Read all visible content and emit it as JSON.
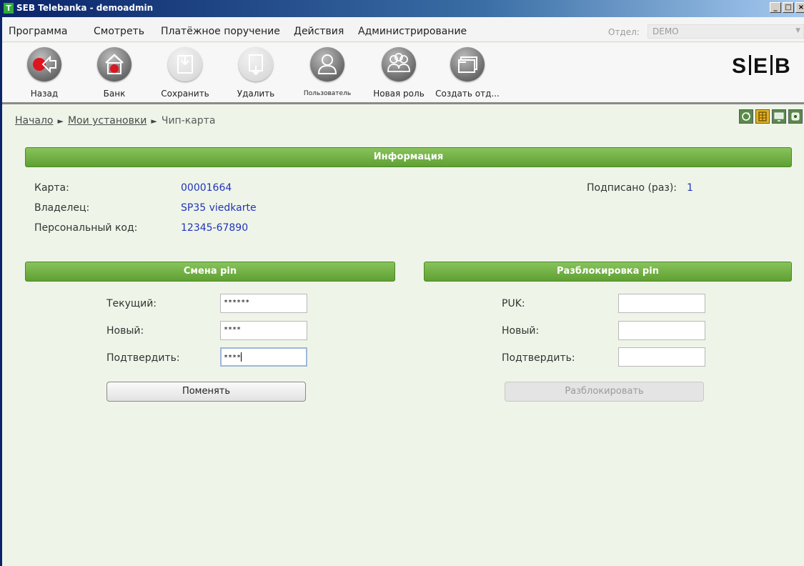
{
  "window": {
    "title": "SEB Telebanka - demoadmin",
    "app_icon_letter": "T",
    "min_glyph": "_",
    "max_glyph": "□",
    "close_glyph": "×"
  },
  "menu": {
    "items": [
      "Программа",
      "Смотреть",
      "Платёжное поручение",
      "Действия",
      "Администрирование"
    ],
    "department_label": "Отдел:",
    "department_value": "DEMO"
  },
  "toolbar": {
    "buttons": [
      {
        "label": "Назад",
        "icon": "back-arrow-icon",
        "enabled": true
      },
      {
        "label": "Банк",
        "icon": "bank-icon",
        "enabled": true
      },
      {
        "label": "Сохранить",
        "icon": "save-icon",
        "enabled": false
      },
      {
        "label": "Удалить",
        "icon": "delete-icon",
        "enabled": false
      },
      {
        "label": "Пользователь",
        "icon": "user-icon",
        "enabled": true
      },
      {
        "label": "Новая роль",
        "icon": "group-icon",
        "enabled": true
      },
      {
        "label": "Создать отд...",
        "icon": "folders-icon",
        "enabled": true
      }
    ],
    "logo": {
      "left": "S",
      "mid": "E",
      "right": "B"
    }
  },
  "breadcrumb": {
    "items": [
      "Начало",
      "Мои установки",
      "Чип-карта"
    ],
    "separator": "►"
  },
  "info": {
    "header": "Информация",
    "card_label": "Карта:",
    "card_value": "00001664",
    "owner_label": "Владелец:",
    "owner_value": "SP35 viedkarte",
    "code_label": "Персональный код:",
    "code_value": "12345-67890",
    "signed_label": "Подписано (раз):",
    "signed_value": "1"
  },
  "change_pin": {
    "header": "Смена pin",
    "current_label": "Текущий:",
    "current_value": "******",
    "new_label": "Новый:",
    "new_value": "****",
    "confirm_label": "Подтвердить:",
    "confirm_value": "****",
    "button": "Поменять"
  },
  "unblock_pin": {
    "header": "Разблокировка pin",
    "puk_label": "PUK:",
    "new_label": "Новый:",
    "confirm_label": "Подтвердить:",
    "button": "Разблокировать"
  },
  "colors": {
    "accent_green": "#5fa032",
    "link_blue": "#2233bb",
    "title_blue": "#0a246a"
  }
}
